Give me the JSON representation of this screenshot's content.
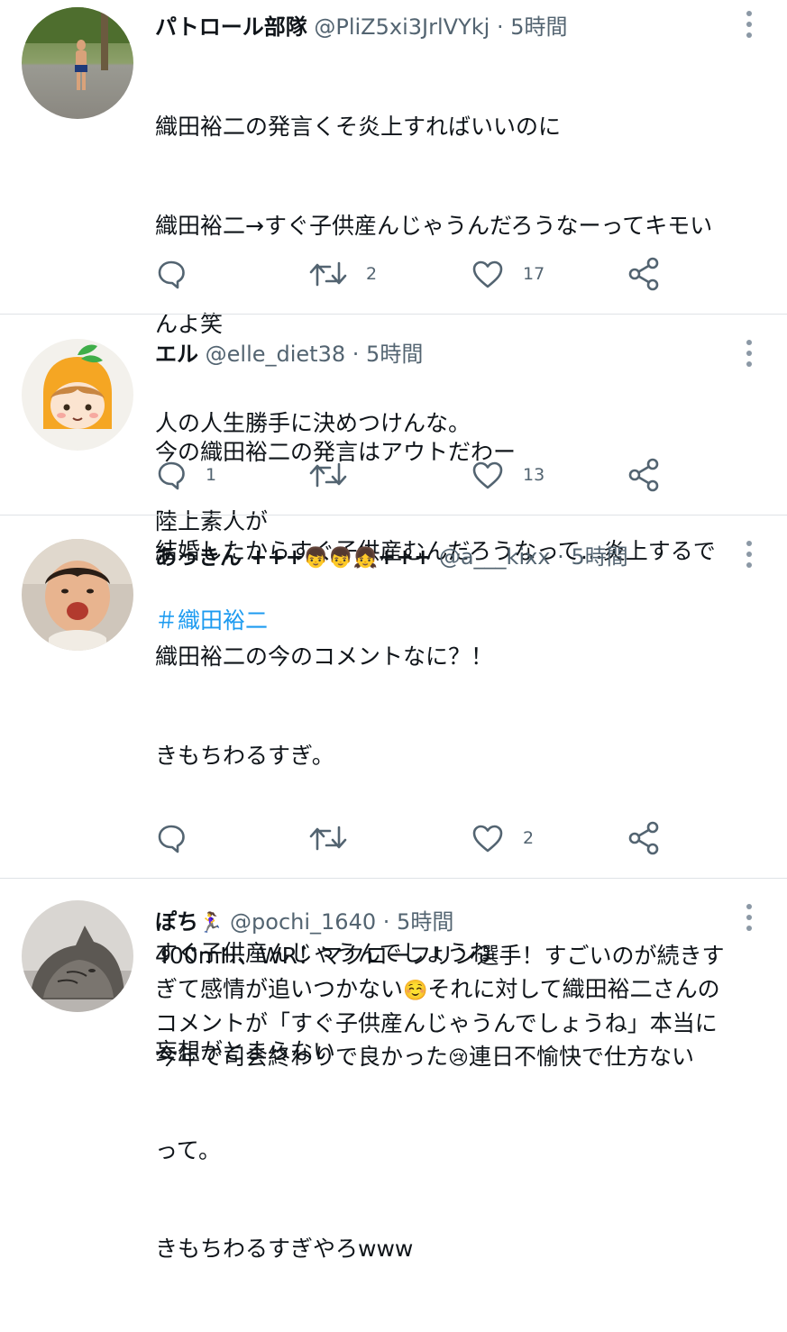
{
  "tweets": [
    {
      "name": "パトロール部隊",
      "handle": "@PliZ5xi3JrlVYkj",
      "dot": "·",
      "time": "5時間",
      "lines": [
        "織田裕二の発言くそ炎上すればいいのに",
        "織田裕二→すぐ子供産んじゃうんだろうなーってキモい",
        "んよ笑",
        "人の人生勝手に決めつけんな。",
        "陸上素人が"
      ],
      "hashtag": "＃織田裕二",
      "reply_count": "",
      "retweet_count": "2",
      "like_count": "17"
    },
    {
      "name": "エル",
      "handle": "@elle_diet38",
      "dot": "·",
      "time": "5時間",
      "lines": [
        "今の織田裕二の発言はアウトだわー",
        "結婚したからすぐ子供産むんだろうなって…炎上するで"
      ],
      "reply_count": "1",
      "retweet_count": "",
      "like_count": "13"
    },
    {
      "name": "あっきん +++",
      "name_emoji": "👦👦👧",
      "name_suffix": "+++",
      "handle": "@a___kixx",
      "dot": "·",
      "time": "5時間",
      "lines": [
        "織田裕二の今のコメントなに？！",
        "きもちわるすぎ。",
        "",
        "すぐ子供産んじゃうんでしょうね",
        "妄想がとまらない",
        "って。",
        "きもちわるすぎやろwww"
      ],
      "reply_count": "",
      "retweet_count": "",
      "like_count": "2"
    },
    {
      "name": "ぽち",
      "name_emoji": "🏃‍♀️",
      "handle": "@pochi_1640",
      "dot": "·",
      "time": "5時間",
      "line1": "400mH、WR！マクローフリン選手！すごいのが続きす",
      "line2a": "ぎて感情が追いつかない",
      "emoji1": "☺️",
      "line2b": "それに対して織田裕二さんの",
      "line3": "コメントが「すぐ子供産んじゃうんでしょうね」本当に",
      "line4a": "今年で司会終わりで良かった",
      "emoji2": "😢",
      "line4b": "連日不愉快で仕方ない"
    }
  ],
  "icons": {
    "reply": "reply-icon",
    "retweet": "retweet-icon",
    "like": "heart-icon",
    "share": "share-icon",
    "more": "more-vertical-icon"
  },
  "colors": {
    "text": "#0f1419",
    "secondary": "#536471",
    "link": "#1d9bf0",
    "divider": "#dfe3e6"
  }
}
